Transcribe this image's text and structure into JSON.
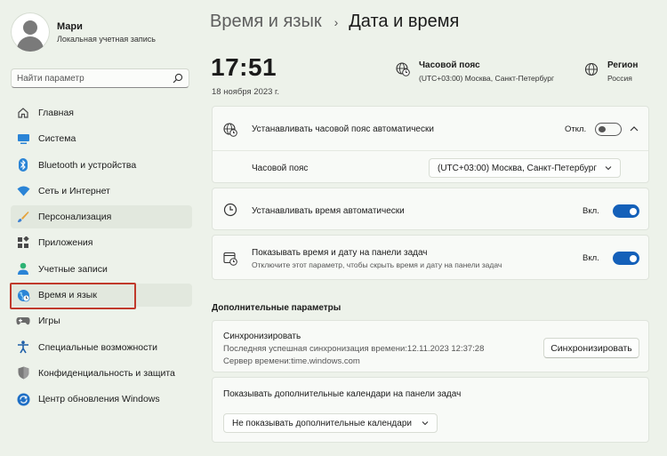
{
  "profile": {
    "name": "Мари",
    "account_type": "Локальная учетная запись"
  },
  "search": {
    "placeholder": "Найти параметр"
  },
  "nav": [
    {
      "label": "Главная",
      "icon": "home-icon"
    },
    {
      "label": "Система",
      "icon": "monitor-icon"
    },
    {
      "label": "Bluetooth и устройства",
      "icon": "bluetooth-icon"
    },
    {
      "label": "Сеть и Интернет",
      "icon": "wifi-icon"
    },
    {
      "label": "Персонализация",
      "icon": "brush-icon"
    },
    {
      "label": "Приложения",
      "icon": "apps-icon"
    },
    {
      "label": "Учетные записи",
      "icon": "person-icon"
    },
    {
      "label": "Время и язык",
      "icon": "globe-clock-icon"
    },
    {
      "label": "Игры",
      "icon": "gamepad-icon"
    },
    {
      "label": "Специальные возможности",
      "icon": "accessibility-icon"
    },
    {
      "label": "Конфиденциальность и защита",
      "icon": "shield-icon"
    },
    {
      "label": "Центр обновления Windows",
      "icon": "update-icon"
    }
  ],
  "breadcrumb": {
    "parent": "Время и язык",
    "separator": "›",
    "current": "Дата и время"
  },
  "clock": {
    "time": "17:51",
    "date": "18 ноября 2023 г."
  },
  "timezone_info": {
    "title": "Часовой пояс",
    "value": "(UTC+03:00) Москва, Санкт-Петербург"
  },
  "region_info": {
    "title": "Регион",
    "value": "Россия"
  },
  "auto_timezone": {
    "label": "Устанавливать часовой пояс автоматически",
    "state_label": "Откл.",
    "enabled": false
  },
  "timezone_select": {
    "label": "Часовой пояс",
    "value": "(UTC+03:00) Москва, Санкт-Петербург"
  },
  "auto_time": {
    "label": "Устанавливать время автоматически",
    "state_label": "Вкл.",
    "enabled": true
  },
  "show_taskbar": {
    "label": "Показывать время и дату на панели задач",
    "description": "Отключите этот параметр, чтобы скрыть время и дату на панели задач",
    "state_label": "Вкл.",
    "enabled": true
  },
  "additional": {
    "title": "Дополнительные параметры"
  },
  "sync": {
    "title": "Синхронизировать",
    "last_sync": "Последняя успешная синхронизация времени:12.11.2023 12:37:28",
    "server": "Сервер времени:time.windows.com",
    "button_label": "Синхронизировать"
  },
  "calendars": {
    "label": "Показывать дополнительные календари на панели задач",
    "value": "Не показывать дополнительные календари"
  },
  "colors": {
    "accent": "#1460b9",
    "highlight": "#c0392b",
    "background": "#edf2ea"
  }
}
